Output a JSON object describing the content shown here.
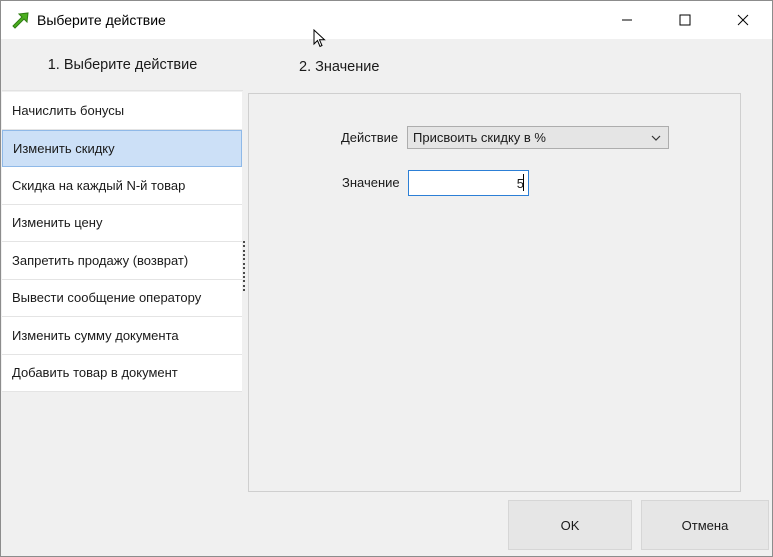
{
  "window": {
    "title": "Выберите действие",
    "colors": {
      "accent": "#2c7fd6",
      "selection": "#cce0f7",
      "app_icon": "#4caf20"
    }
  },
  "left_panel": {
    "header": "1. Выберите  действие",
    "items": [
      {
        "label": "Начислить бонусы",
        "selected": false
      },
      {
        "label": "Изменить скидку",
        "selected": true
      },
      {
        "label": "Скидка на каждый N-й товар",
        "selected": false
      },
      {
        "label": "Изменить цену",
        "selected": false
      },
      {
        "label": "Запретить продажу (возврат)",
        "selected": false
      },
      {
        "label": "Вывести сообщение оператору",
        "selected": false
      },
      {
        "label": "Изменить сумму документа",
        "selected": false
      },
      {
        "label": "Добавить товар в документ",
        "selected": false
      }
    ]
  },
  "right_panel": {
    "header": "2. Значение",
    "action_label": "Действие",
    "action_value": "Присвоить скидку в %",
    "value_label": "Значение",
    "value": "5"
  },
  "buttons": {
    "ok": "OK",
    "cancel": "Отмена"
  }
}
